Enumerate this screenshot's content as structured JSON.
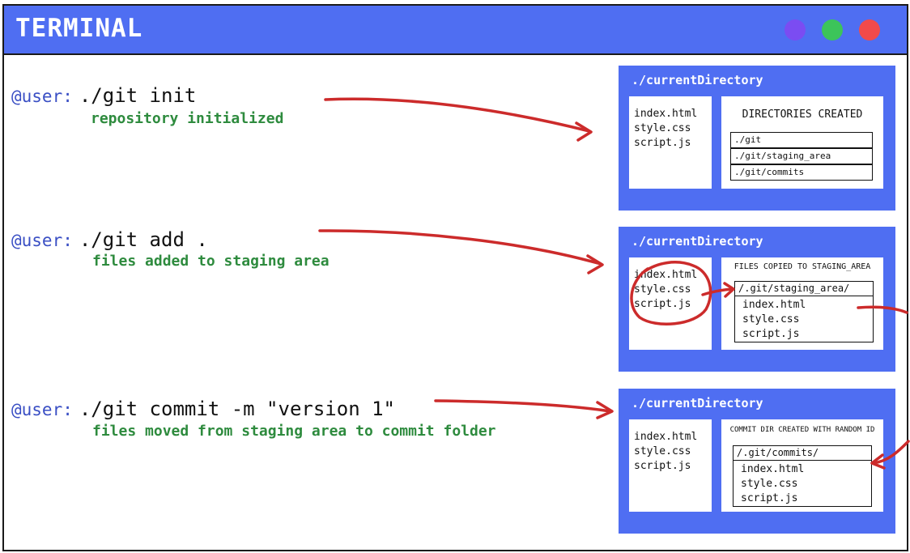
{
  "window": {
    "title": "TERMINAL",
    "dots": [
      "#7b4cf2",
      "#3cc45a",
      "#f24a4a"
    ]
  },
  "colors": {
    "accent": "#4f6ef2",
    "prompt": "#3a4fc4",
    "output": "#2e8b3e",
    "annotation": "#cc2b2b"
  },
  "commands": [
    {
      "prompt": "@user:",
      "command": "./git init",
      "output": "repository initialized"
    },
    {
      "prompt": "@user:",
      "command": "./git add .",
      "output": "files added to staging area"
    },
    {
      "prompt": "@user:",
      "command": "./git commit -m \"version 1\"",
      "output": "files moved from staging area to commit folder"
    }
  ],
  "panels": [
    {
      "title": "./currentDirectory",
      "files": [
        "index.html",
        "style.css",
        "script.js"
      ],
      "info_title": "DIRECTORIES CREATED",
      "dirs": [
        "./git",
        "./git/staging_area",
        "./git/commits"
      ]
    },
    {
      "title": "./currentDirectory",
      "files": [
        "index.html",
        "style.css",
        "script.js"
      ],
      "info_title": "FILES COPIED TO STAGING_AREA",
      "list_head": "/.git/staging_area/",
      "list_files": [
        "index.html",
        "style.css",
        "script.js"
      ]
    },
    {
      "title": "./currentDirectory",
      "files": [
        "index.html",
        "style.css",
        "script.js"
      ],
      "info_title": "COMMIT DIR CREATED WITH RANDOM ID",
      "list_head": "/.git/commits/",
      "list_files": [
        "index.html",
        "style.css",
        "script.js"
      ]
    }
  ]
}
